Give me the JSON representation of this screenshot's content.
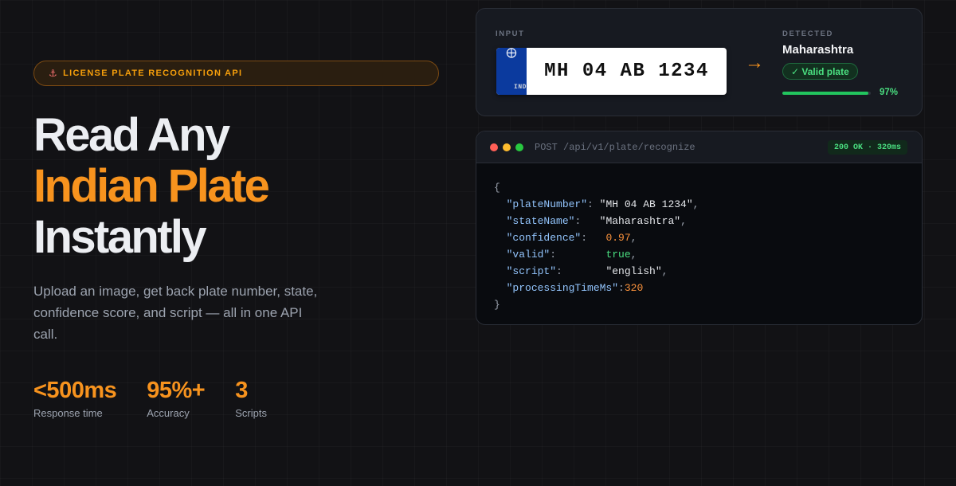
{
  "hero": {
    "badge_icon": "car-icon",
    "badge_text": "LICENSE PLATE RECOGNITION API",
    "headline_line1": "Read Any",
    "headline_line2": "Indian Plate",
    "headline_line3": "Instantly",
    "subtitle": "Upload an image, get back plate number, state, confidence score, and script — all in one API call."
  },
  "stats": [
    {
      "value": "<500ms",
      "label": "Response time"
    },
    {
      "value": "95%+",
      "label": "Accuracy"
    },
    {
      "value": "3",
      "label": "Scripts"
    }
  ],
  "detection": {
    "input_label": "INPUT",
    "detected_label": "DETECTED",
    "plate_country_code": "IND",
    "plate_number": "MH 04 AB 1234",
    "state": "Maharashtra",
    "valid_label": "✓ Valid plate",
    "confidence_percent": 97,
    "confidence_label": "97%"
  },
  "api": {
    "endpoint": "POST /api/v1/plate/recognize",
    "status": "200 OK · 320ms",
    "response": {
      "open": "{",
      "close": "}",
      "fields": [
        {
          "key": "\"plateNumber\"",
          "value": "\"MH 04 AB 1234\"",
          "type": "string"
        },
        {
          "key": "\"stateName\"",
          "value": "\"Maharashtra\"",
          "type": "string"
        },
        {
          "key": "\"confidence\"",
          "value": "0.97",
          "type": "number"
        },
        {
          "key": "\"valid\"",
          "value": "true",
          "type": "bool"
        },
        {
          "key": "\"script\"",
          "value": "\"english\"",
          "type": "string"
        },
        {
          "key": "\"processingTimeMs\"",
          "value": "320",
          "type": "number"
        }
      ]
    }
  },
  "colors": {
    "accent": "#f7931e",
    "success": "#4ade80",
    "plate_blue": "#0b3a9e",
    "traffic_red": "#ff5f57",
    "traffic_yellow": "#febc2e",
    "traffic_green": "#28c840"
  }
}
